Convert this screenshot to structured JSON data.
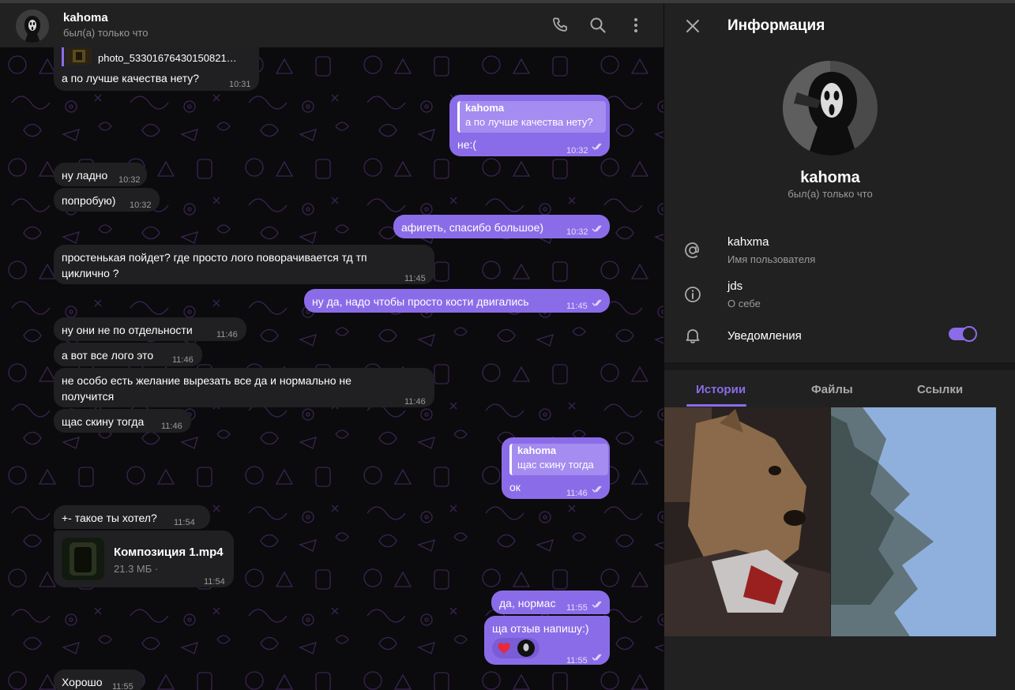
{
  "chat": {
    "name": "kahoma",
    "status": "был(а) только что",
    "messages": [
      {
        "id": "m1",
        "dir": "in",
        "attachment": "photo_53301676430150821…",
        "text": "а по лучше качества нету?",
        "time": "10:31"
      },
      {
        "id": "m2",
        "dir": "out",
        "reply_name": "kahoma",
        "reply_text": "а по лучше качества нету?",
        "text": "не:(",
        "time": "10:32"
      },
      {
        "id": "m3",
        "dir": "in",
        "text": "ну ладно",
        "time": "10:32"
      },
      {
        "id": "m4",
        "dir": "in",
        "text": "попробую)",
        "time": "10:32"
      },
      {
        "id": "m5",
        "dir": "out",
        "text": "афигеть, спасибо большое)",
        "time": "10:32"
      },
      {
        "id": "m6",
        "dir": "in",
        "text": "простенькая пойдет? где просто лого поворачивается тд тп",
        "text2": "циклично ?",
        "time": "11:45"
      },
      {
        "id": "m7",
        "dir": "out",
        "text": "ну да, надо чтобы просто кости двигались",
        "time": "11:45"
      },
      {
        "id": "m8",
        "dir": "in",
        "text": "ну они не по отдельности",
        "time": "11:46"
      },
      {
        "id": "m9",
        "dir": "in",
        "text": "а вот все лого это",
        "time": "11:46"
      },
      {
        "id": "m10",
        "dir": "in",
        "text": "не особо есть желание вырезать все да и нормально не",
        "text2": "получится",
        "time": "11:46"
      },
      {
        "id": "m11",
        "dir": "in",
        "text": "щас скину тогда",
        "time": "11:46"
      },
      {
        "id": "m12",
        "dir": "out",
        "reply_name": "kahoma",
        "reply_text": "щас скину тогда",
        "text": "ок",
        "time": "11:46"
      },
      {
        "id": "m13",
        "dir": "in",
        "text": "+- такое ты хотел?",
        "time": "11:54"
      },
      {
        "id": "m14",
        "dir": "in",
        "file_name": "Композиция 1.mp4",
        "file_size": "21.3 МБ ·",
        "time": "11:54"
      },
      {
        "id": "m15",
        "dir": "out",
        "text": "да, нормас",
        "time": "11:55"
      },
      {
        "id": "m16",
        "dir": "out",
        "text": "ща отзыв напишу:)",
        "time": "11:55"
      },
      {
        "id": "m17",
        "dir": "in",
        "text": "Хорошо",
        "time": "11:55"
      }
    ]
  },
  "panel": {
    "title": "Информация",
    "name": "kahoma",
    "status": "был(а) только что",
    "username": "kahxma",
    "username_label": "Имя пользователя",
    "bio": "jds",
    "bio_label": "О себе",
    "notifications_label": "Уведомления",
    "notifications_on": true,
    "tabs": [
      "Истории",
      "Файлы",
      "Ссылки"
    ],
    "active_tab": "Истории"
  },
  "colors": {
    "accent": "#8b6ce8",
    "incoming_bubble": "#202022",
    "chat_background": "#0b0a0d",
    "panel_background": "#212121"
  }
}
